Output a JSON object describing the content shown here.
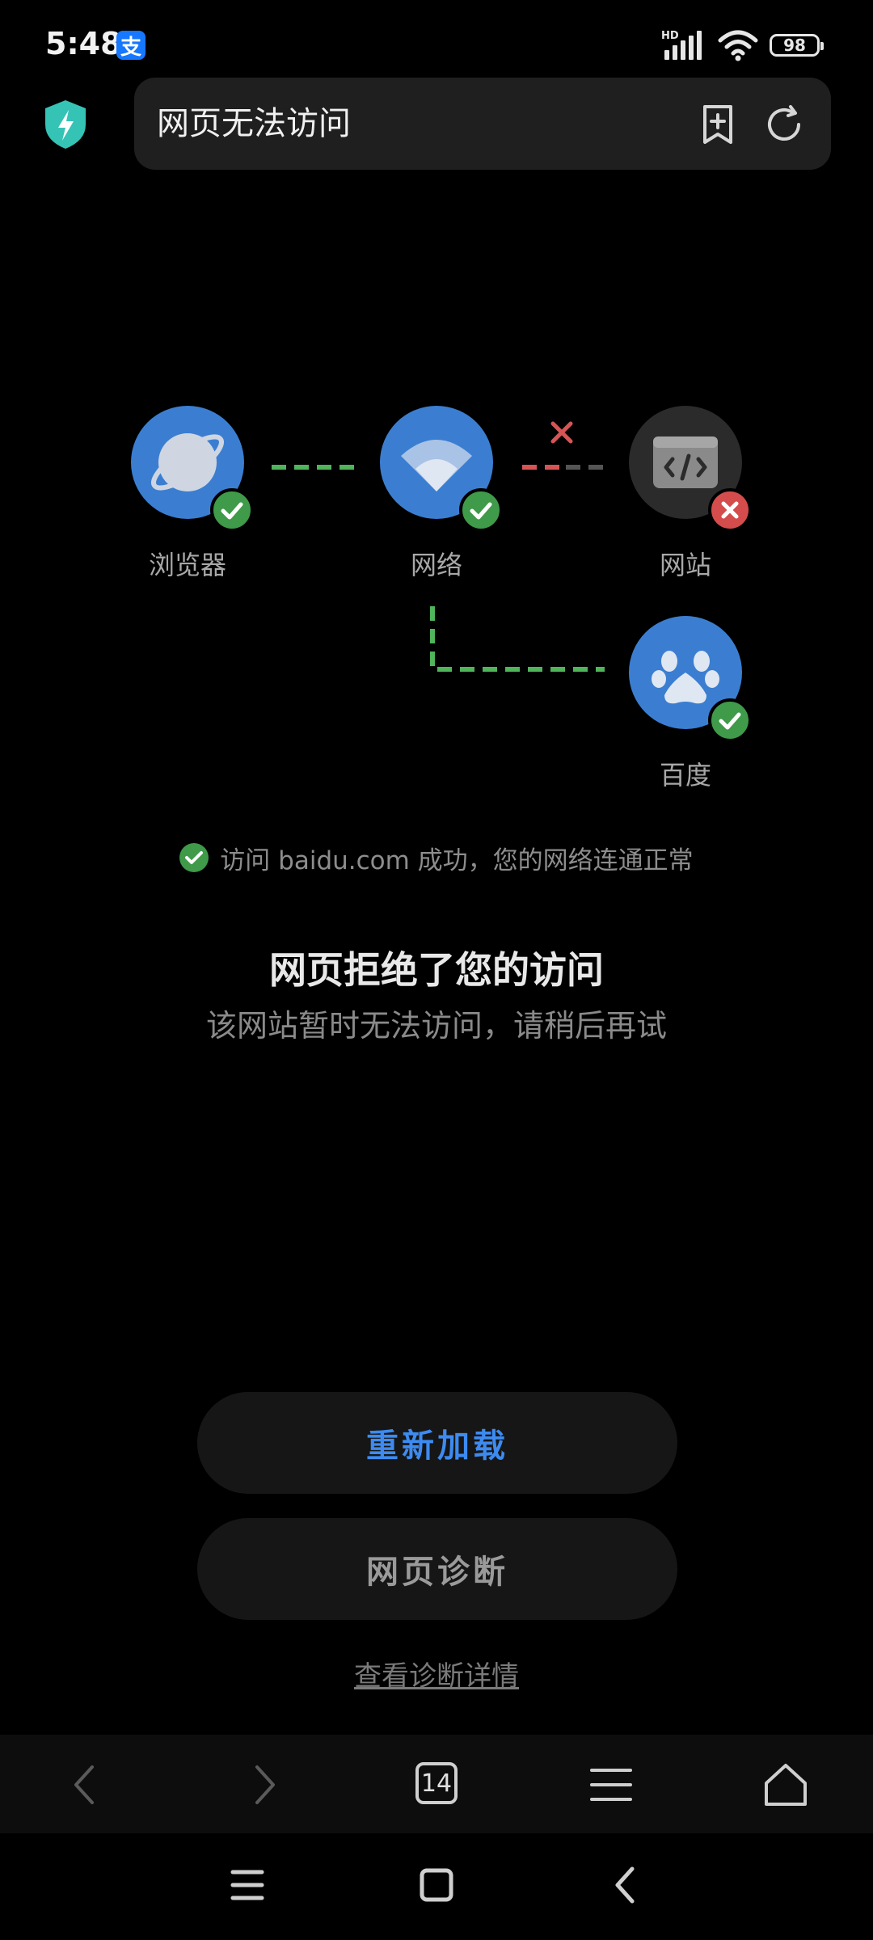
{
  "status_bar": {
    "time": "5:48",
    "alipay_badge": "支",
    "network_label": "HD",
    "battery": "98"
  },
  "address_bar": {
    "title": "网页无法访问"
  },
  "diagram": {
    "nodes": [
      {
        "label": "浏览器",
        "status": "ok"
      },
      {
        "label": "网络",
        "status": "ok"
      },
      {
        "label": "网站",
        "status": "error"
      },
      {
        "label": "百度",
        "status": "ok"
      }
    ],
    "status_message": "访问 baidu.com 成功，您的网络连通正常"
  },
  "error": {
    "title": "网页拒绝了您的访问",
    "subtitle": "该网站暂时无法访问，请稍后再试"
  },
  "actions": {
    "reload": "重新加载",
    "diagnose": "网页诊断",
    "details_link": "查看诊断详情"
  },
  "toolbar": {
    "tab_count": "14"
  },
  "colors": {
    "accent": "#3d8bf0",
    "ok": "#3f9a49",
    "error": "#d54c4c",
    "node_blue": "#3b7ed1"
  }
}
